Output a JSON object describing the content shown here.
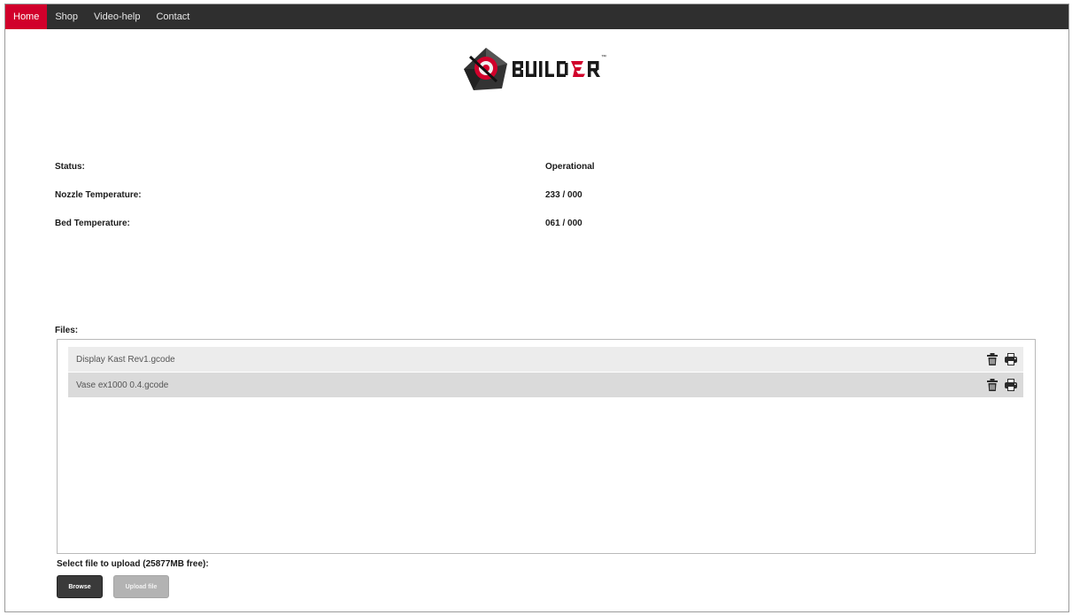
{
  "nav": {
    "items": [
      {
        "label": "Home",
        "active": true
      },
      {
        "label": "Shop",
        "active": false
      },
      {
        "label": "Video-help",
        "active": false
      },
      {
        "label": "Contact",
        "active": false
      }
    ]
  },
  "logo": {
    "text": "BUILDER",
    "tm": "™",
    "icon": "cube-logo-icon"
  },
  "status": {
    "rows": [
      {
        "label": "Status:",
        "value": "Operational"
      },
      {
        "label": "Nozzle Temperature:",
        "value": "233 / 000"
      },
      {
        "label": "Bed Temperature:",
        "value": "061 / 000"
      }
    ]
  },
  "files": {
    "label": "Files:",
    "items": [
      {
        "name": "Display Kast Rev1.gcode"
      },
      {
        "name": "Vase ex1000 0.4.gcode"
      }
    ],
    "icons": {
      "delete": "trash-icon",
      "print": "printer-icon"
    }
  },
  "upload": {
    "label": "Select file to upload (25877MB free):",
    "browse_label": "Browse",
    "upload_label": "Upload file"
  },
  "colors": {
    "nav_bg": "#2f2f2f",
    "accent": "#d1002b",
    "row_light": "#ececec",
    "row_dark": "#dadada"
  }
}
